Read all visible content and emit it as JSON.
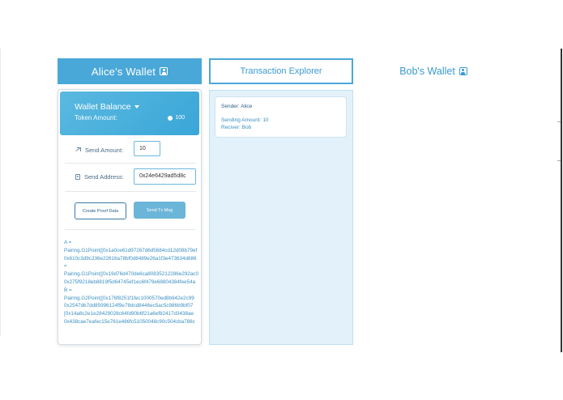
{
  "alice": {
    "title": "Alice's Wallet",
    "balance_title": "Wallet Balance",
    "token_label": "Token Amount:",
    "token_value": "100",
    "send_amount_label": "Send Amount:",
    "send_amount_value": "10",
    "send_address_label": "Send Address:",
    "send_address_value": "0x24e6429ad5d8c",
    "create_proof_label": "Create Proof Data",
    "send_tx_label": "Send Tx Msg",
    "proof_lines": [
      "A =",
      "Pairing.G1Point([0x1a0ce61d97267d6d5684cd12d08b79ef",
      "0x610c3d9c236e22616a78bf0d8489e26a1f3e473634d886",
      "=",
      "Pairing.G1Point([0x19d76d470de6ca80835212286e292ac0",
      "0x275f9218eb8819f5d64745ef1ec6f479e68804384fee54a",
      "B =",
      "Pairing.G2Point([0x176f8251f1fec1000570ed8b942e2c99",
      "0x2547db7dd85996124f9e78dcd8446ec5ac5c986b9bf07",
      "[0x14a8c2e1e28429028c64fd90b6f21a6ef82417d3438ae",
      "0x438cae7eafec15e761e486fc51050048c90c504cba788c"
    ]
  },
  "explorer": {
    "title": "Transaction Explorer",
    "tx": {
      "sender": "Sender: Alice",
      "amount": "Sending Amount: 10",
      "receiver": "Reciver: Bob"
    }
  },
  "bob": {
    "title": "Bob's Wallet"
  },
  "colors": {
    "accent": "#4aa8d8",
    "panel_bg": "#e2f1fa",
    "link_text": "#3a8fc2"
  }
}
